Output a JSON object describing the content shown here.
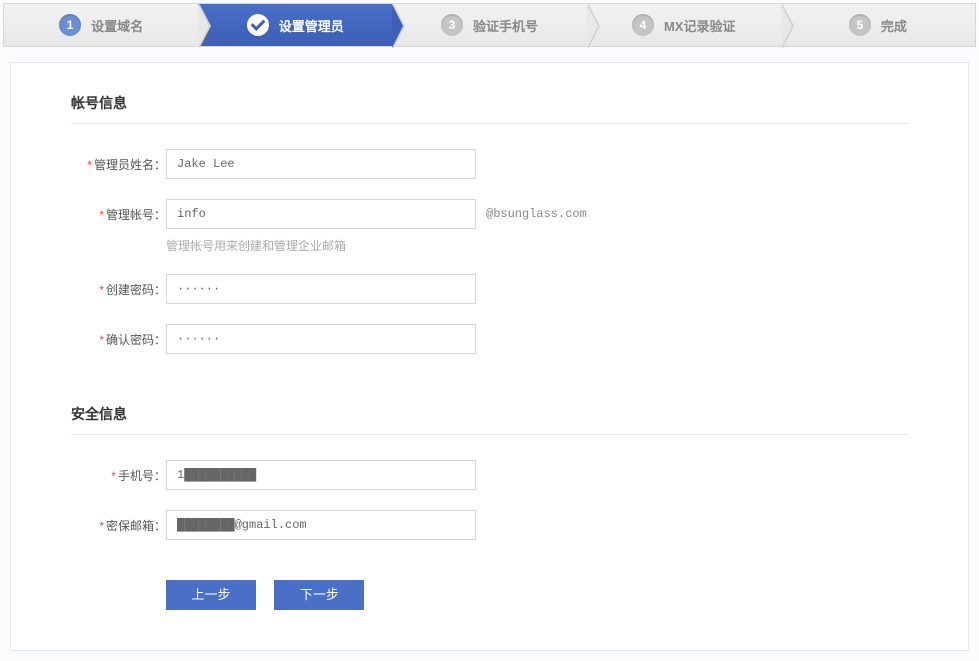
{
  "steps": [
    {
      "num": "1",
      "label": "设置域名"
    },
    {
      "num": "✓",
      "label": "设置管理员"
    },
    {
      "num": "3",
      "label": "验证手机号"
    },
    {
      "num": "4",
      "label": "MX记录验证"
    },
    {
      "num": "5",
      "label": "完成"
    }
  ],
  "sections": {
    "account": {
      "title": "帐号信息",
      "admin_name": {
        "label": "管理员姓名：",
        "value": "Jake Lee"
      },
      "admin_account": {
        "label": "管理帐号：",
        "value": "info",
        "suffix": "@bsunglass.com",
        "helper": "管理帐号用来创建和管理企业邮箱"
      },
      "create_password": {
        "label": "创建密码：",
        "value": "······"
      },
      "confirm_password": {
        "label": "确认密码：",
        "value": "······"
      }
    },
    "security": {
      "title": "安全信息",
      "phone": {
        "label": "手机号：",
        "value": "1██████████"
      },
      "recovery_email": {
        "label": "密保邮箱：",
        "value": "████████@gmail.com"
      }
    }
  },
  "buttons": {
    "prev": "上一步",
    "next": "下一步"
  }
}
